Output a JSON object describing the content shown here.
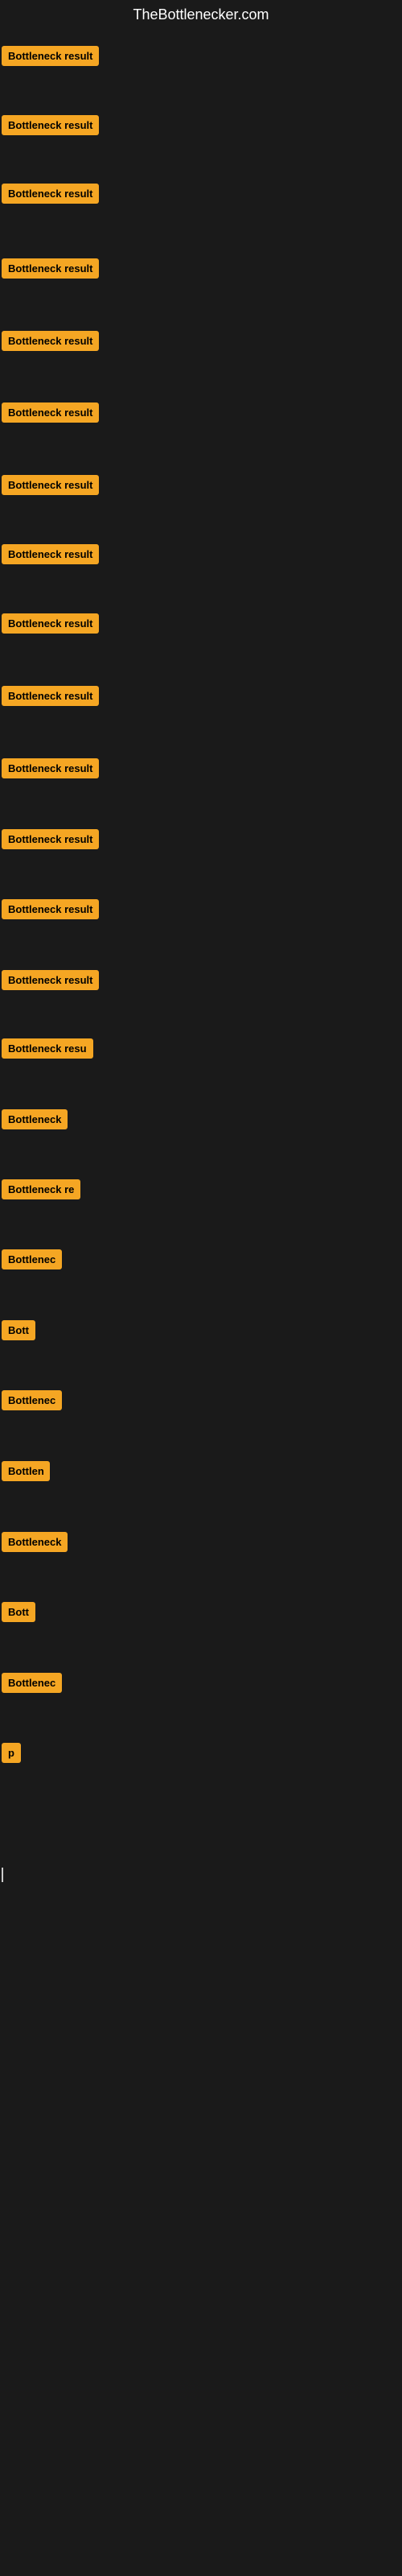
{
  "site": {
    "title": "TheBottlenecker.com"
  },
  "cards": [
    {
      "id": 1,
      "label": "Bottleneck result",
      "width_class": "full",
      "row_class": "row-1"
    },
    {
      "id": 2,
      "label": "Bottleneck result",
      "width_class": "full",
      "row_class": "row-2"
    },
    {
      "id": 3,
      "label": "Bottleneck result",
      "width_class": "full",
      "row_class": "row-3"
    },
    {
      "id": 4,
      "label": "Bottleneck result",
      "width_class": "full",
      "row_class": "row-4"
    },
    {
      "id": 5,
      "label": "Bottleneck result",
      "width_class": "full",
      "row_class": "row-5"
    },
    {
      "id": 6,
      "label": "Bottleneck result",
      "width_class": "full",
      "row_class": "row-6"
    },
    {
      "id": 7,
      "label": "Bottleneck result",
      "width_class": "full",
      "row_class": "row-7"
    },
    {
      "id": 8,
      "label": "Bottleneck result",
      "width_class": "full",
      "row_class": "row-8"
    },
    {
      "id": 9,
      "label": "Bottleneck result",
      "width_class": "full",
      "row_class": "row-9"
    },
    {
      "id": 10,
      "label": "Bottleneck result",
      "width_class": "full",
      "row_class": "row-10"
    },
    {
      "id": 11,
      "label": "Bottleneck result",
      "width_class": "full",
      "row_class": "row-11"
    },
    {
      "id": 12,
      "label": "Bottleneck result",
      "width_class": "full",
      "row_class": "row-12"
    },
    {
      "id": 13,
      "label": "Bottleneck result",
      "width_class": "full",
      "row_class": "row-13"
    },
    {
      "id": 14,
      "label": "Bottleneck result",
      "width_class": "full",
      "row_class": "row-14"
    },
    {
      "id": 15,
      "label": "Bottleneck resu",
      "width_class": "w-160",
      "row_class": "row-15"
    },
    {
      "id": 16,
      "label": "Bottleneck",
      "width_class": "w-100",
      "row_class": "row-16"
    },
    {
      "id": 17,
      "label": "Bottleneck re",
      "width_class": "w-120",
      "row_class": "row-17"
    },
    {
      "id": 18,
      "label": "Bottlenec",
      "width_class": "w-80",
      "row_class": "row-18"
    },
    {
      "id": 19,
      "label": "Bott",
      "width_class": "w-50",
      "row_class": "row-19"
    },
    {
      "id": 20,
      "label": "Bottlenec",
      "width_class": "w-80",
      "row_class": "row-20"
    },
    {
      "id": 21,
      "label": "Bottlen",
      "width_class": "w-60",
      "row_class": "row-21"
    },
    {
      "id": 22,
      "label": "Bottleneck",
      "width_class": "w-100",
      "row_class": "row-22"
    },
    {
      "id": 23,
      "label": "Bott",
      "width_class": "w-50",
      "row_class": "row-23"
    },
    {
      "id": 24,
      "label": "Bottlenec",
      "width_class": "w-80",
      "row_class": "row-24"
    },
    {
      "id": 25,
      "label": "p",
      "width_class": "w-40",
      "row_class": "row-25"
    }
  ],
  "colors": {
    "card_bg": "#f5a623",
    "card_text": "#000000",
    "site_title": "#ffffff",
    "background": "#1a1a1a"
  }
}
